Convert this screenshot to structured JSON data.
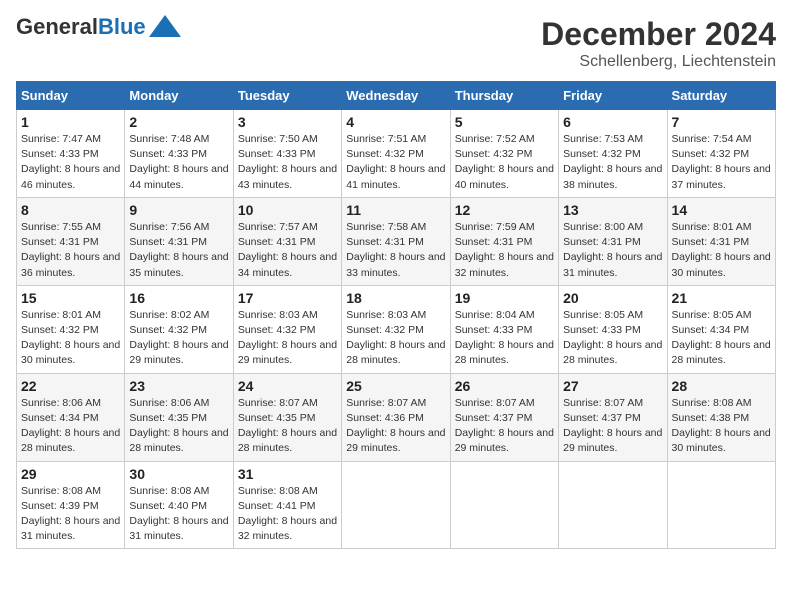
{
  "header": {
    "logo_general": "General",
    "logo_blue": "Blue",
    "month_title": "December 2024",
    "location": "Schellenberg, Liechtenstein"
  },
  "days_of_week": [
    "Sunday",
    "Monday",
    "Tuesday",
    "Wednesday",
    "Thursday",
    "Friday",
    "Saturday"
  ],
  "weeks": [
    [
      {
        "day": "1",
        "sunrise": "7:47 AM",
        "sunset": "4:33 PM",
        "daylight": "8 hours and 46 minutes."
      },
      {
        "day": "2",
        "sunrise": "7:48 AM",
        "sunset": "4:33 PM",
        "daylight": "8 hours and 44 minutes."
      },
      {
        "day": "3",
        "sunrise": "7:50 AM",
        "sunset": "4:33 PM",
        "daylight": "8 hours and 43 minutes."
      },
      {
        "day": "4",
        "sunrise": "7:51 AM",
        "sunset": "4:32 PM",
        "daylight": "8 hours and 41 minutes."
      },
      {
        "day": "5",
        "sunrise": "7:52 AM",
        "sunset": "4:32 PM",
        "daylight": "8 hours and 40 minutes."
      },
      {
        "day": "6",
        "sunrise": "7:53 AM",
        "sunset": "4:32 PM",
        "daylight": "8 hours and 38 minutes."
      },
      {
        "day": "7",
        "sunrise": "7:54 AM",
        "sunset": "4:32 PM",
        "daylight": "8 hours and 37 minutes."
      }
    ],
    [
      {
        "day": "8",
        "sunrise": "7:55 AM",
        "sunset": "4:31 PM",
        "daylight": "8 hours and 36 minutes."
      },
      {
        "day": "9",
        "sunrise": "7:56 AM",
        "sunset": "4:31 PM",
        "daylight": "8 hours and 35 minutes."
      },
      {
        "day": "10",
        "sunrise": "7:57 AM",
        "sunset": "4:31 PM",
        "daylight": "8 hours and 34 minutes."
      },
      {
        "day": "11",
        "sunrise": "7:58 AM",
        "sunset": "4:31 PM",
        "daylight": "8 hours and 33 minutes."
      },
      {
        "day": "12",
        "sunrise": "7:59 AM",
        "sunset": "4:31 PM",
        "daylight": "8 hours and 32 minutes."
      },
      {
        "day": "13",
        "sunrise": "8:00 AM",
        "sunset": "4:31 PM",
        "daylight": "8 hours and 31 minutes."
      },
      {
        "day": "14",
        "sunrise": "8:01 AM",
        "sunset": "4:31 PM",
        "daylight": "8 hours and 30 minutes."
      }
    ],
    [
      {
        "day": "15",
        "sunrise": "8:01 AM",
        "sunset": "4:32 PM",
        "daylight": "8 hours and 30 minutes."
      },
      {
        "day": "16",
        "sunrise": "8:02 AM",
        "sunset": "4:32 PM",
        "daylight": "8 hours and 29 minutes."
      },
      {
        "day": "17",
        "sunrise": "8:03 AM",
        "sunset": "4:32 PM",
        "daylight": "8 hours and 29 minutes."
      },
      {
        "day": "18",
        "sunrise": "8:03 AM",
        "sunset": "4:32 PM",
        "daylight": "8 hours and 28 minutes."
      },
      {
        "day": "19",
        "sunrise": "8:04 AM",
        "sunset": "4:33 PM",
        "daylight": "8 hours and 28 minutes."
      },
      {
        "day": "20",
        "sunrise": "8:05 AM",
        "sunset": "4:33 PM",
        "daylight": "8 hours and 28 minutes."
      },
      {
        "day": "21",
        "sunrise": "8:05 AM",
        "sunset": "4:34 PM",
        "daylight": "8 hours and 28 minutes."
      }
    ],
    [
      {
        "day": "22",
        "sunrise": "8:06 AM",
        "sunset": "4:34 PM",
        "daylight": "8 hours and 28 minutes."
      },
      {
        "day": "23",
        "sunrise": "8:06 AM",
        "sunset": "4:35 PM",
        "daylight": "8 hours and 28 minutes."
      },
      {
        "day": "24",
        "sunrise": "8:07 AM",
        "sunset": "4:35 PM",
        "daylight": "8 hours and 28 minutes."
      },
      {
        "day": "25",
        "sunrise": "8:07 AM",
        "sunset": "4:36 PM",
        "daylight": "8 hours and 29 minutes."
      },
      {
        "day": "26",
        "sunrise": "8:07 AM",
        "sunset": "4:37 PM",
        "daylight": "8 hours and 29 minutes."
      },
      {
        "day": "27",
        "sunrise": "8:07 AM",
        "sunset": "4:37 PM",
        "daylight": "8 hours and 29 minutes."
      },
      {
        "day": "28",
        "sunrise": "8:08 AM",
        "sunset": "4:38 PM",
        "daylight": "8 hours and 30 minutes."
      }
    ],
    [
      {
        "day": "29",
        "sunrise": "8:08 AM",
        "sunset": "4:39 PM",
        "daylight": "8 hours and 31 minutes."
      },
      {
        "day": "30",
        "sunrise": "8:08 AM",
        "sunset": "4:40 PM",
        "daylight": "8 hours and 31 minutes."
      },
      {
        "day": "31",
        "sunrise": "8:08 AM",
        "sunset": "4:41 PM",
        "daylight": "8 hours and 32 minutes."
      },
      null,
      null,
      null,
      null
    ]
  ],
  "labels": {
    "sunrise": "Sunrise:",
    "sunset": "Sunset:",
    "daylight": "Daylight:"
  }
}
